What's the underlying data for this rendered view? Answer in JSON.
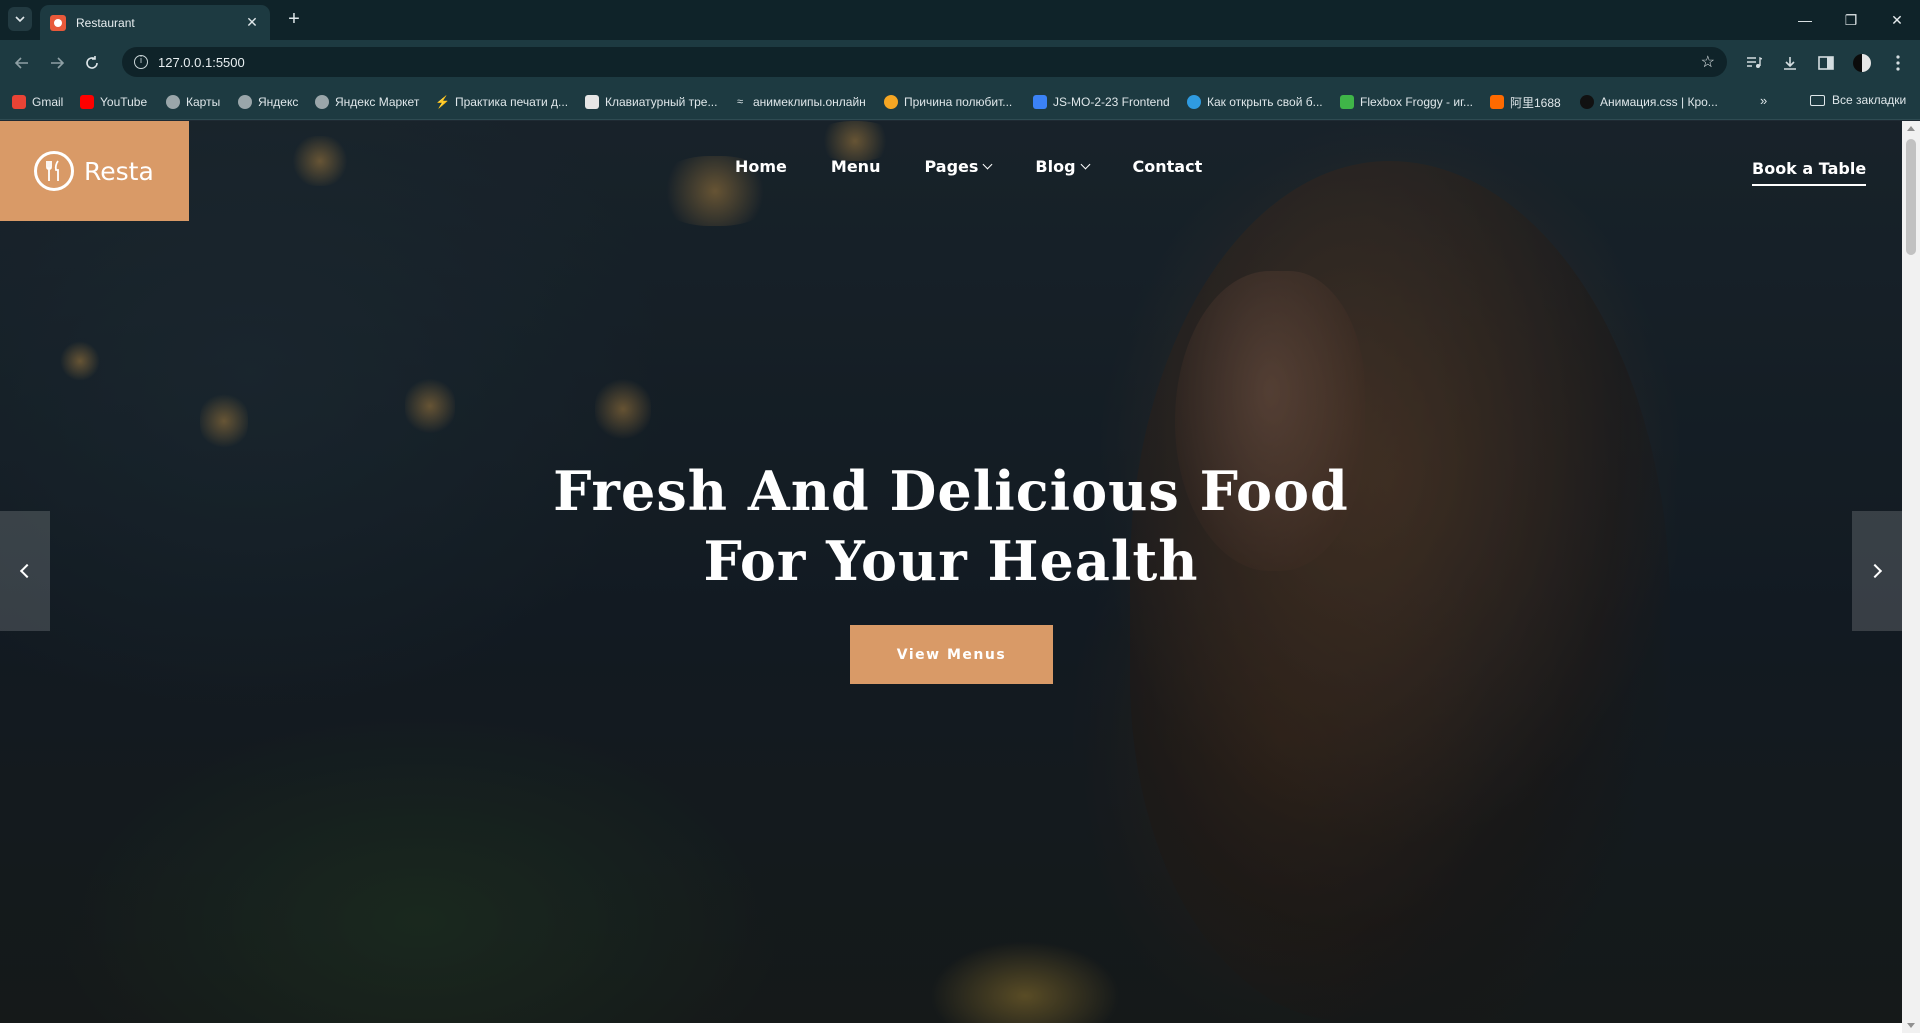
{
  "browser": {
    "tab_title": "Restaurant",
    "url": "127.0.0.1:5500",
    "tab_close": "✕",
    "new_tab": "+",
    "window_controls": [
      "—",
      "❐",
      "✕"
    ],
    "bookmarks": [
      {
        "label": "Gmail",
        "color": "#ea4335"
      },
      {
        "label": "YouTube",
        "color": "#ff0000"
      },
      {
        "label": "Карты",
        "color": "#9aa6aa"
      },
      {
        "label": "Яндекс",
        "color": "#9aa6aa"
      },
      {
        "label": "Яндекс Маркет",
        "color": "#9aa6aa"
      },
      {
        "label": "Практика печати д...",
        "color": "#1d3a41"
      },
      {
        "label": "Клавиатурный тре...",
        "color": "#e6e6e6"
      },
      {
        "label": "анимеклипы.онлайн",
        "color": "#1d3a41"
      },
      {
        "label": "Причина полюбит...",
        "color": "#f5a623"
      },
      {
        "label": "JS-MO-2-23 Frontend",
        "color": "#3b82f6"
      },
      {
        "label": "Как открыть свой б...",
        "color": "#2f9be0"
      },
      {
        "label": "Flexbox Froggy - иг...",
        "color": "#3fb548"
      },
      {
        "label": "阿里1688",
        "color": "#ff6a00"
      },
      {
        "label": "Анимация.css | Кро...",
        "color": "#111111"
      }
    ],
    "more_bookmarks": "»",
    "all_bookmarks": "Все закладки"
  },
  "site": {
    "logo_text": "Resta",
    "nav": [
      {
        "label": "Home",
        "dropdown": false
      },
      {
        "label": "Menu",
        "dropdown": false
      },
      {
        "label": "Pages",
        "dropdown": true
      },
      {
        "label": "Blog",
        "dropdown": true
      },
      {
        "label": "Contact",
        "dropdown": false
      }
    ],
    "book_table": "Book a Table",
    "hero": {
      "title_line1": "Fresh And Delicious Food",
      "title_line2": "For Your Health",
      "button": "View Menus"
    },
    "accent_color": "#d99a67"
  }
}
